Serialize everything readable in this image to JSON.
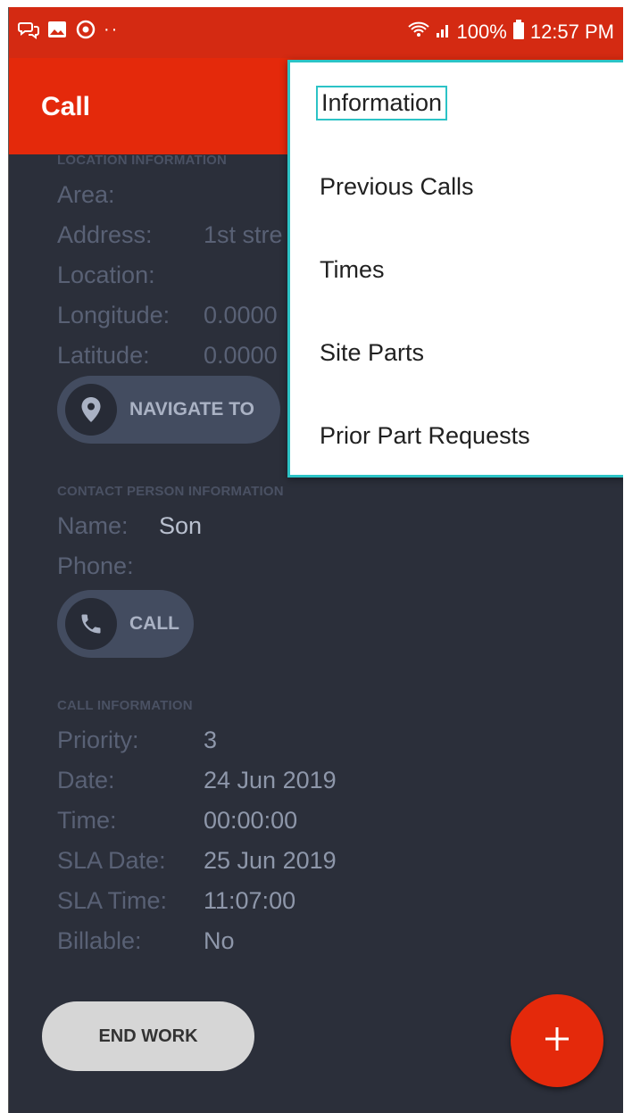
{
  "app": {
    "title": "Call",
    "colors": {
      "accent": "#e4290b",
      "statusbar": "#d42a12",
      "background": "#2b2f3a",
      "focus_ring": "#2cc3c6"
    }
  },
  "status_bar": {
    "battery": "100%",
    "time": "12:57 PM",
    "dots": "··"
  },
  "location": {
    "section_title": "LOCATION INFORMATION",
    "rows": [
      {
        "label": "Area:",
        "value": ""
      },
      {
        "label": "Address:",
        "value": "1st stre"
      },
      {
        "label": "Location:",
        "value": ""
      },
      {
        "label": "Longitude:",
        "value": "0.0000"
      },
      {
        "label": "Latitude:",
        "value": "0.0000"
      }
    ],
    "navigate_label": "NAVIGATE TO"
  },
  "contact": {
    "section_title": "CONTACT PERSON INFORMATION",
    "rows": [
      {
        "label": "Name:",
        "value": "Son"
      },
      {
        "label": "Phone:",
        "value": ""
      }
    ],
    "call_label": "CALL"
  },
  "call_info": {
    "section_title": "CALL INFORMATION",
    "rows": [
      {
        "label": "Priority:",
        "value": "3"
      },
      {
        "label": "Date:",
        "value": "24 Jun 2019"
      },
      {
        "label": "Time:",
        "value": "00:00:00"
      },
      {
        "label": "SLA Date:",
        "value": "25 Jun 2019"
      },
      {
        "label": "SLA Time:",
        "value": "11:07:00"
      },
      {
        "label": "Billable:",
        "value": "No"
      }
    ]
  },
  "actions": {
    "end_work_label": "END WORK",
    "fab_icon": "plus-icon"
  },
  "menu": {
    "items": [
      {
        "label": "Information"
      },
      {
        "label": "Previous Calls"
      },
      {
        "label": "Times"
      },
      {
        "label": "Site Parts"
      },
      {
        "label": "Prior Part Requests"
      }
    ]
  }
}
